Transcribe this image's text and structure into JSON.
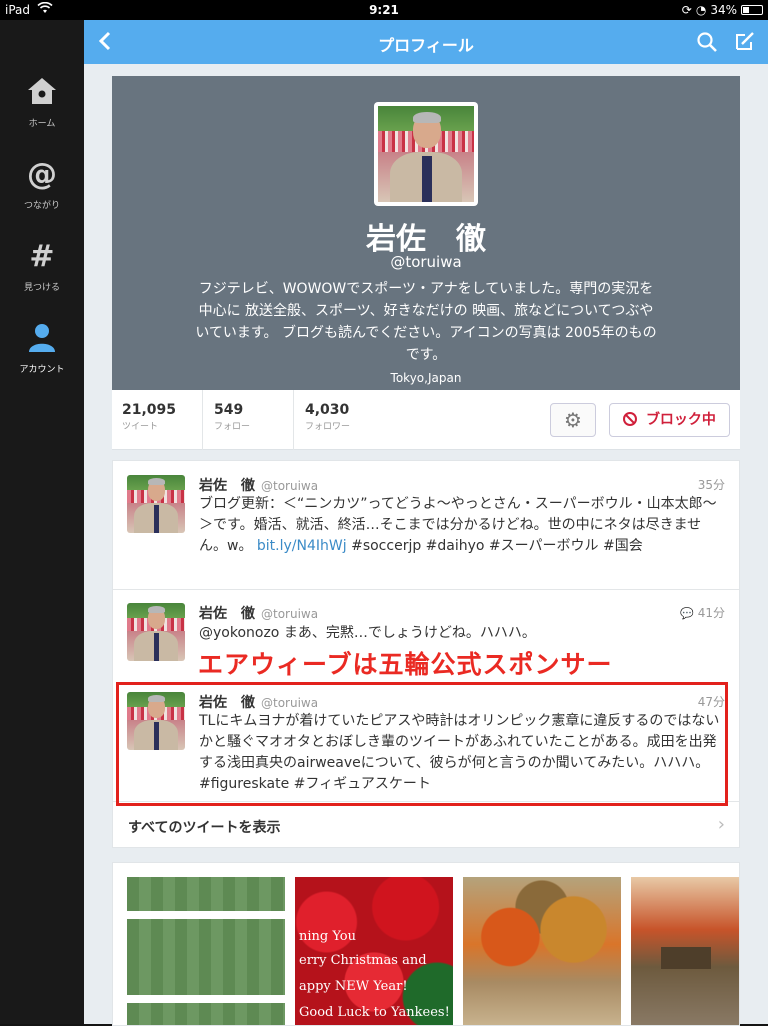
{
  "status": {
    "device": "iPad",
    "time": "9:21",
    "battery": "34%"
  },
  "sidebar": {
    "items": [
      {
        "label": "ホーム",
        "icon": "home-icon"
      },
      {
        "label": "つながり",
        "icon": "at-icon"
      },
      {
        "label": "見つける",
        "icon": "hash-icon"
      },
      {
        "label": "アカウント",
        "icon": "person-icon"
      }
    ]
  },
  "nav": {
    "title": "プロフィール"
  },
  "profile": {
    "name": "岩佐　徹",
    "handle": "@toruiwa",
    "bio": "フジテレビ、WOWOWでスポーツ・アナをしていました。専門の実況を中心に 放送全般、スポーツ、好きなだけの 映画、旅などについてつぶやいています。 ブログも読んでください。アイコンの写真は 2005年のものです。",
    "location": "Tokyo,Japan"
  },
  "stats": [
    {
      "num": "21,095",
      "label": "ツイート"
    },
    {
      "num": "549",
      "label": "フォロー"
    },
    {
      "num": "4,030",
      "label": "フォロワー"
    }
  ],
  "actions": {
    "block_label": "ブロック中"
  },
  "tweets": [
    {
      "name": "岩佐　徹",
      "handle": "@toruiwa",
      "time": "35分",
      "text": "ブログ更新：＜“ニンカツ”ってどうよ〜やっとさん・スーパーボウル・山本太郎〜＞です。婚活、就活、終活…そこまでは分かるけどね。世の中にネタは尽きません。w。",
      "link": "bit.ly/N4IhWj",
      "tail": "#soccerjp #daihyo #スーパーボウル #国会"
    },
    {
      "name": "岩佐　徹",
      "handle": "@toruiwa",
      "time": "41分",
      "text": "@yokonozo まあ、完黙…でしょうけどね。ハハハ。"
    },
    {
      "name": "岩佐　徹",
      "handle": "@toruiwa",
      "time": "47分",
      "text": "TLにキムヨナが着けていたピアスや時計はオリンピック憲章に違反するのではないかと騒ぐマオオタとおぼしき輩のツイートがあふれていたことがある。成田を出発する浅田真央のairweaveについて、彼らが何と言うのか聞いてみたい。ハハハ。 #figureskate #フィギュアスケート"
    }
  ],
  "annotation": "エアウィーブは五輪公式スポンサー",
  "show_all": "すべてのツイートを表示",
  "media": {
    "card_lines": [
      "ning You",
      "erry Christmas and",
      "appy NEW Year!",
      "Good Luck to Yankees!"
    ]
  }
}
